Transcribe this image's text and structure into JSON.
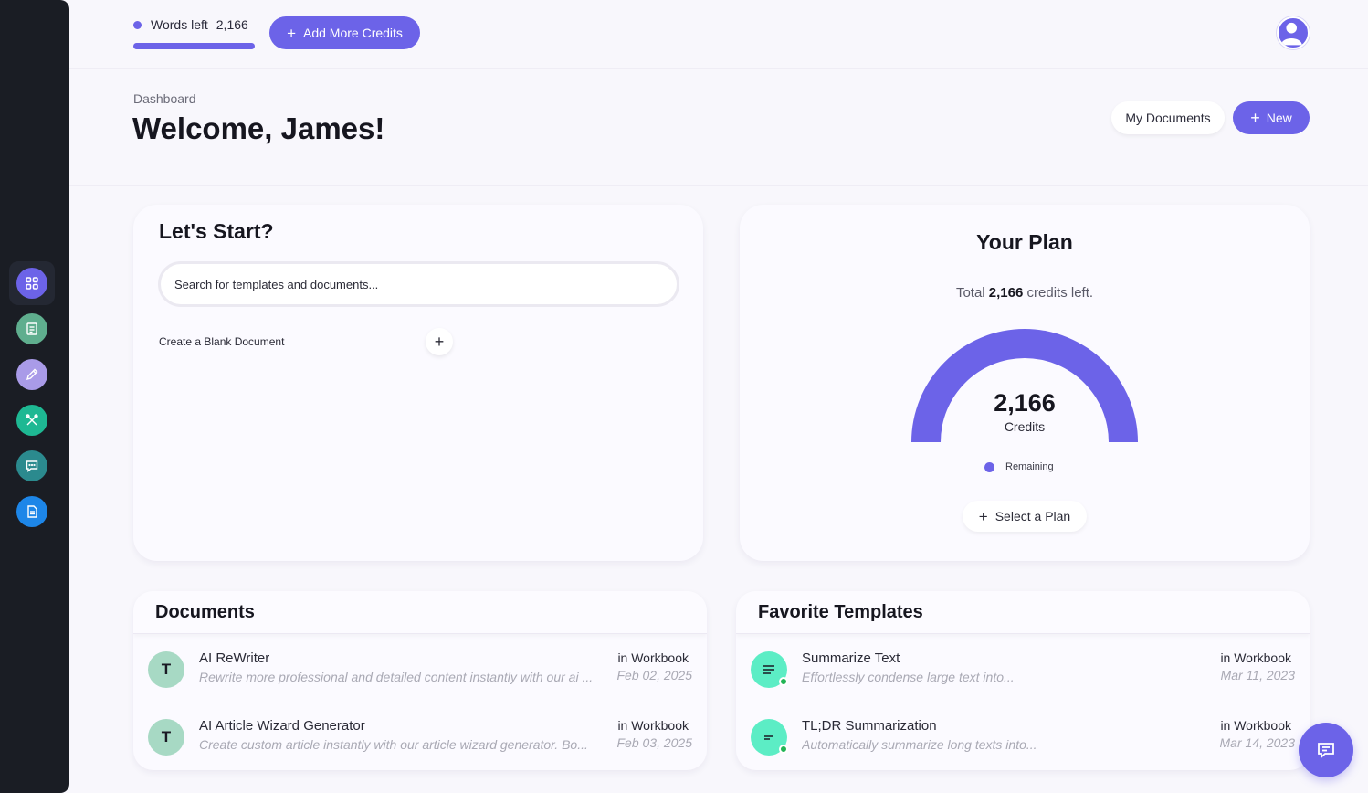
{
  "topbar": {
    "words_left_label": "Words left",
    "words_left_value": "2,166",
    "words_left_fraction": 1.0,
    "add_credits_label": "Add More Credits"
  },
  "header": {
    "breadcrumb": "Dashboard",
    "title": "Welcome, James!",
    "my_documents_label": "My Documents",
    "new_label": "New"
  },
  "sidebar": {
    "items": [
      {
        "name": "dashboard",
        "icon": "grid-icon",
        "color": "#6c63e8",
        "active": true
      },
      {
        "name": "documents",
        "icon": "document-add-icon",
        "color": "#5fae8e"
      },
      {
        "name": "editor",
        "icon": "pen-icon",
        "color": "#a99be8"
      },
      {
        "name": "tools",
        "icon": "tools-icon",
        "color": "#1eb893"
      },
      {
        "name": "chat",
        "icon": "chat-icon",
        "color": "#2b8a8e"
      },
      {
        "name": "files",
        "icon": "file-icon",
        "color": "#1d86e8"
      }
    ]
  },
  "start": {
    "title": "Let's Start?",
    "search_placeholder": "Search for templates and documents...",
    "blank_label": "Create a Blank Document"
  },
  "plan": {
    "title": "Your Plan",
    "total_prefix": "Total",
    "total_value": "2,166",
    "total_suffix": "credits left.",
    "gauge_value": "2,166",
    "gauge_label": "Credits",
    "remaining_fraction": 1.0,
    "legend_label": "Remaining",
    "select_plan_label": "Select a Plan",
    "accent": "#6c63e8"
  },
  "documents": {
    "title": "Documents",
    "rows": [
      {
        "initial": "T",
        "name": "AI ReWriter",
        "desc": "Rewrite more professional and detailed content instantly with our ai ...",
        "location": "in Workbook",
        "date": "Feb 02, 2025"
      },
      {
        "initial": "T",
        "name": "AI Article Wizard Generator",
        "desc": "Create custom article instantly with our article wizard generator. Bo...",
        "location": "in Workbook",
        "date": "Feb 03, 2025"
      }
    ]
  },
  "favorites": {
    "title": "Favorite Templates",
    "rows": [
      {
        "icon": "lines-icon",
        "name": "Summarize Text",
        "desc": "Effortlessly condense large text into...",
        "location": "in Workbook",
        "date": "Mar 11, 2023"
      },
      {
        "icon": "tldr-icon",
        "name": "TL;DR Summarization",
        "desc": "Automatically summarize long texts into...",
        "location": "in Workbook",
        "date": "Mar 14, 2023"
      }
    ]
  }
}
